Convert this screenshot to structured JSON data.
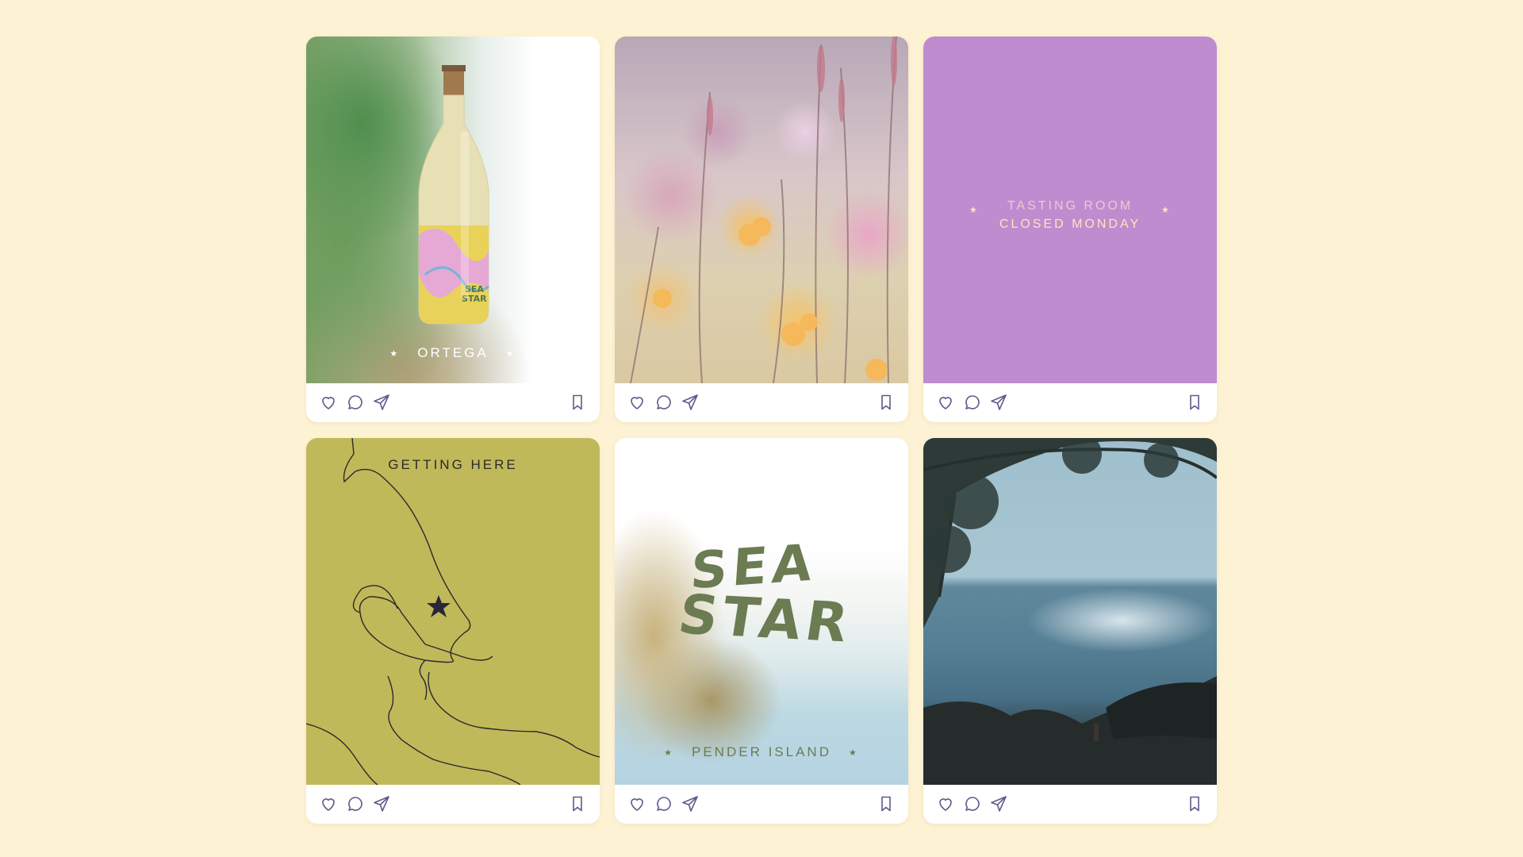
{
  "colors": {
    "background": "#fdf2d3",
    "purple": "#bf8ccf",
    "map_olive": "#c0b95a",
    "logo_green": "#6b7b52",
    "icon_stroke": "#5b5b8a"
  },
  "posts": [
    {
      "image": "wine-bottle-photo",
      "caption": "ORTEGA",
      "caption_color": "#ffffff",
      "actions": [
        "heart-icon",
        "comment-icon",
        "send-icon",
        "bookmark-icon"
      ]
    },
    {
      "image": "wildflowers-photo",
      "actions": [
        "heart-icon",
        "comment-icon",
        "send-icon",
        "bookmark-icon"
      ]
    },
    {
      "line1": "TASTING ROOM",
      "line2": "CLOSED MONDAY",
      "line1_color": "#f1c6d8",
      "line2_color": "#fbe6b8",
      "actions": [
        "heart-icon",
        "comment-icon",
        "send-icon",
        "bookmark-icon"
      ]
    },
    {
      "image": "island-map",
      "caption": "GETTING HERE",
      "actions": [
        "heart-icon",
        "comment-icon",
        "send-icon",
        "bookmark-icon"
      ]
    },
    {
      "logo_line1": "SEA",
      "logo_line2": "STAR",
      "caption": "PENDER ISLAND",
      "actions": [
        "heart-icon",
        "comment-icon",
        "send-icon",
        "bookmark-icon"
      ]
    },
    {
      "image": "ocean-rocks-photo",
      "actions": [
        "heart-icon",
        "comment-icon",
        "send-icon",
        "bookmark-icon"
      ]
    }
  ]
}
